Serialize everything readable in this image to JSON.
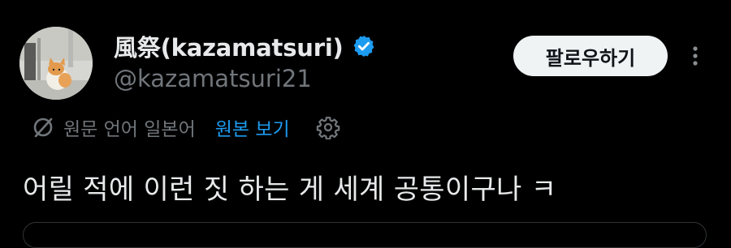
{
  "author": {
    "display_name": "風祭(kazamatsuri)",
    "handle": "@kazamatsuri21",
    "verified": true,
    "verified_color": "#1d9bf0"
  },
  "actions": {
    "follow_label": "팔로우하기",
    "more_icon": "more-vertical-icon"
  },
  "translation": {
    "original_language_text": "원문 언어 일본어",
    "view_original_label": "원본 보기",
    "icon": "translate-icon",
    "settings_icon": "gear-icon"
  },
  "tweet": {
    "text": "어릴 적에 이런 짓 하는 게 세계 공통이구나 ㅋ"
  },
  "colors": {
    "background": "#000000",
    "primary_text": "#e7e9ea",
    "secondary_text": "#71767b",
    "link": "#1d9bf0",
    "follow_button_bg": "#eff3f4"
  }
}
